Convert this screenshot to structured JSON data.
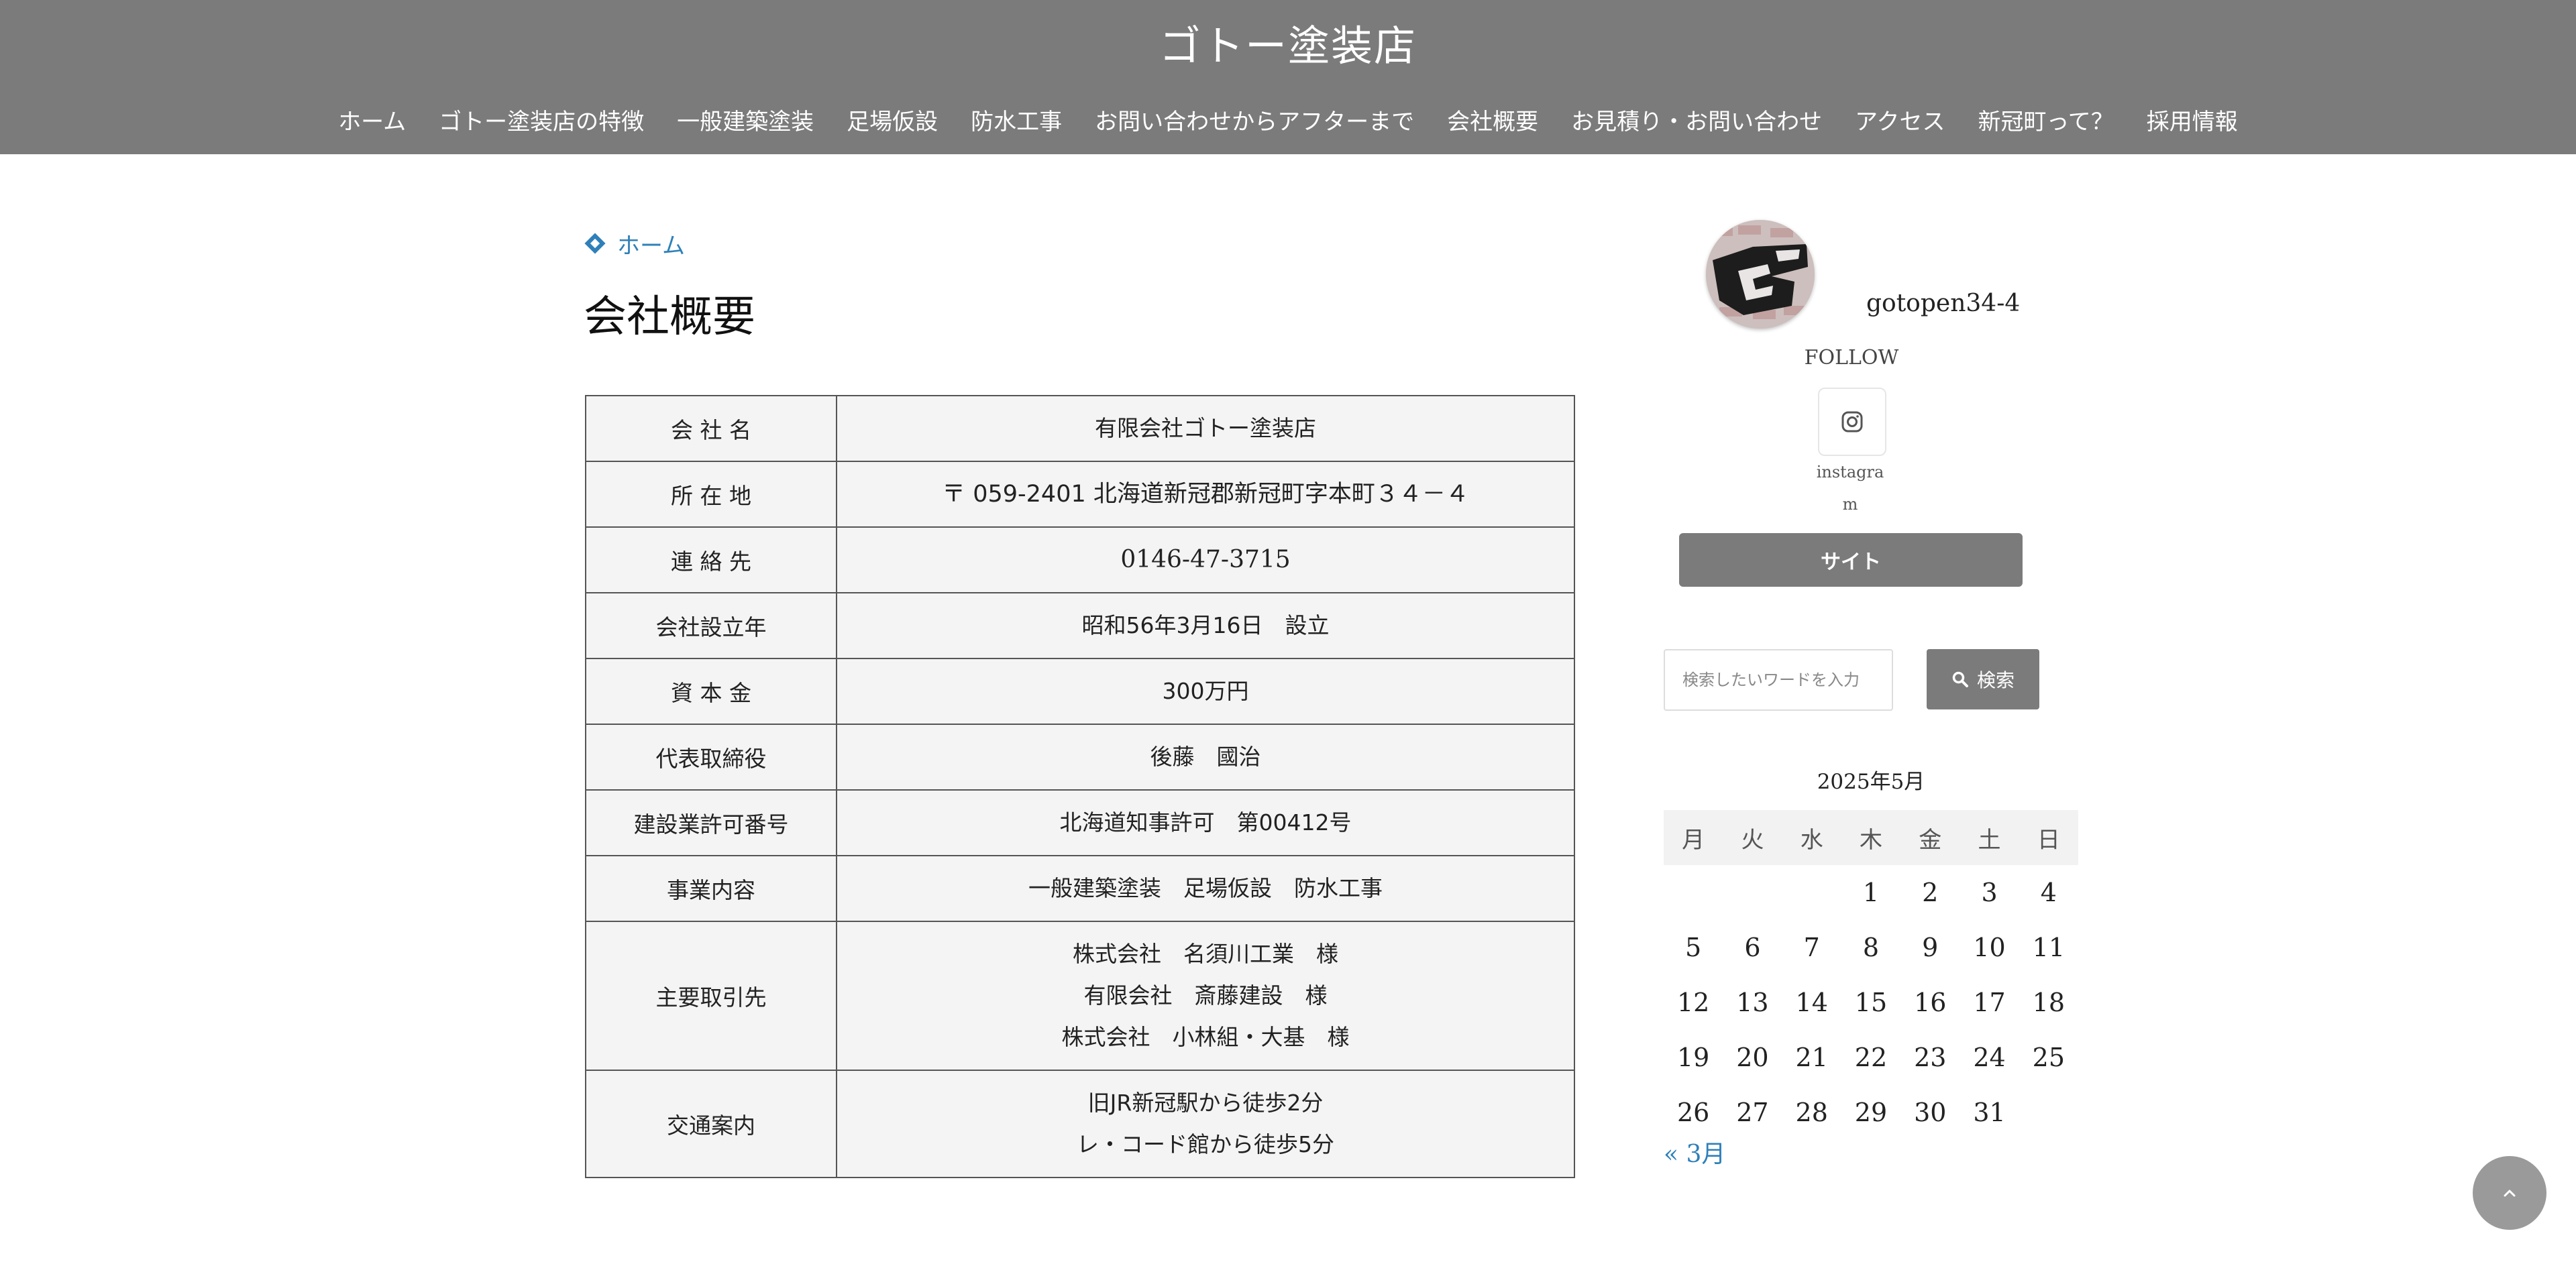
{
  "header": {
    "site_title": "ゴトー塗装店",
    "nav": [
      "ホーム",
      "ゴトー塗装店の特徴",
      "一般建築塗装",
      "足場仮設",
      "防水工事",
      "お問い合わせからアフターまで",
      "会社概要",
      "お見積り・お問い合わせ",
      "アクセス",
      "新冠町って？",
      "採用情報"
    ]
  },
  "breadcrumb": {
    "home": "ホーム"
  },
  "page": {
    "title": "会社概要"
  },
  "company_table": [
    {
      "label": "会 社 名",
      "lines": [
        "有限会社ゴトー塗装店"
      ]
    },
    {
      "label": "所 在 地",
      "lines": [
        "〒 059-2401 北海道新冠郡新冠町字本町３４－４"
      ]
    },
    {
      "label": "連 絡 先",
      "lines": [
        "0146-47-3715"
      ]
    },
    {
      "label": "会社設立年",
      "lines": [
        "昭和56年3月16日　設立"
      ]
    },
    {
      "label": "資 本 金",
      "lines": [
        "300万円"
      ]
    },
    {
      "label": "代表取締役",
      "lines": [
        "後藤　國治"
      ]
    },
    {
      "label": "建設業許可番号",
      "lines": [
        "北海道知事許可　第00412号"
      ]
    },
    {
      "label": "事業内容",
      "lines": [
        "一般建築塗装　足場仮設　防水工事"
      ]
    },
    {
      "label": "主要取引先",
      "lines": [
        "株式会社　名須川工業　様",
        "有限会社　斎藤建設　様",
        "株式会社　小林組・大基　様"
      ]
    },
    {
      "label": "交通案内",
      "lines": [
        "旧JR新冠駅から徒歩2分",
        "レ・コード館から徒歩5分"
      ]
    }
  ],
  "sidebar": {
    "instagram": {
      "username": "gotopen34-4",
      "follow_label": "FOLLOW",
      "icon": "instagram-icon",
      "label": "instagram"
    },
    "site_button": "サイト",
    "search": {
      "placeholder": "検索したいワードを入力",
      "button_label": "検索"
    },
    "calendar": {
      "caption": "2025年5月",
      "weekdays": [
        "月",
        "火",
        "水",
        "木",
        "金",
        "土",
        "日"
      ],
      "weeks": [
        [
          "",
          "",
          "",
          "1",
          "2",
          "3",
          "4"
        ],
        [
          "5",
          "6",
          "7",
          "8",
          "9",
          "10",
          "11"
        ],
        [
          "12",
          "13",
          "14",
          "15",
          "16",
          "17",
          "18"
        ],
        [
          "19",
          "20",
          "21",
          "22",
          "23",
          "24",
          "25"
        ],
        [
          "26",
          "27",
          "28",
          "29",
          "30",
          "31",
          ""
        ]
      ],
      "prev_link": "« 3月"
    }
  },
  "colors": {
    "header_bg": "#7b7b7b",
    "link": "#2f80b9",
    "table_bg": "#f4f4f4"
  }
}
